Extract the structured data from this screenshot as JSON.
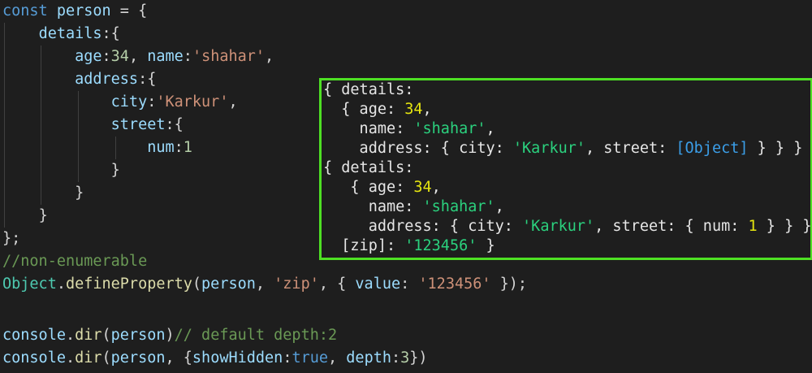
{
  "code": {
    "l1": {
      "kw": "const",
      "var": "person",
      "rest": " = {"
    },
    "l2": {
      "key": "details",
      "rest": ":{"
    },
    "l3": {
      "k1": "age",
      "c1": ":",
      "v1": "34",
      "sep": ", ",
      "k2": "name",
      "c2": ":",
      "v2": "'shahar'",
      "end": ","
    },
    "l4": {
      "key": "address",
      "rest": ":{"
    },
    "l5": {
      "key": "city",
      "c": ":",
      "val": "'Karkur'",
      "end": ","
    },
    "l6": {
      "key": "street",
      "rest": ":{"
    },
    "l7": {
      "key": "num",
      "c": ":",
      "val": "1"
    },
    "l8": "}",
    "l9": "}",
    "l10": "}",
    "l11": "};",
    "l12": "//non-enumerable",
    "l13": {
      "obj": "Object",
      "dot": ".",
      "fn": "defineProperty",
      "p1": "(",
      "arg1": "person",
      "p2": ", ",
      "str": "'zip'",
      "p3": ", { ",
      "key": "value",
      "p4": ": ",
      "val": "'123456'",
      "p5": " });"
    },
    "l15": {
      "obj": "console",
      "dot": ".",
      "fn": "dir",
      "p1": "(",
      "arg": "person",
      "p2": ")",
      "comment": "// default depth:2"
    },
    "l16": {
      "obj": "console",
      "dot": ".",
      "fn": "dir",
      "p1": "(",
      "arg": "person",
      "p2": ", {",
      "k1": "showHidden",
      "c1": ":",
      "v1": "true",
      "sep": ", ",
      "k2": "depth",
      "c2": ":",
      "v2": "3",
      "end": "})"
    }
  },
  "console": {
    "o1": {
      "a": "{ details:",
      "b1": "  { age: ",
      "b2": "34",
      "b3": ",",
      "c1": "    name: ",
      "c2": "'shahar'",
      "c3": ",",
      "d1": "    address: { city: ",
      "d2": "'Karkur'",
      "d3": ", street: ",
      "d4": "[Object]",
      "d5": " } } }"
    },
    "o2": {
      "a": "{ details:",
      "b1": "   { age: ",
      "b2": "34",
      "b3": ",",
      "c1": "     name: ",
      "c2": "'shahar'",
      "c3": ",",
      "d1": "     address: { city: ",
      "d2": "'Karkur'",
      "d3": ", street: { num: ",
      "d4": "1",
      "d5": " } } },",
      "e1": "  [zip]: ",
      "e2": "'123456'",
      "e3": " }"
    }
  },
  "colors": {
    "highlight_border": "#4ee024",
    "background": "#1e1e1e"
  }
}
